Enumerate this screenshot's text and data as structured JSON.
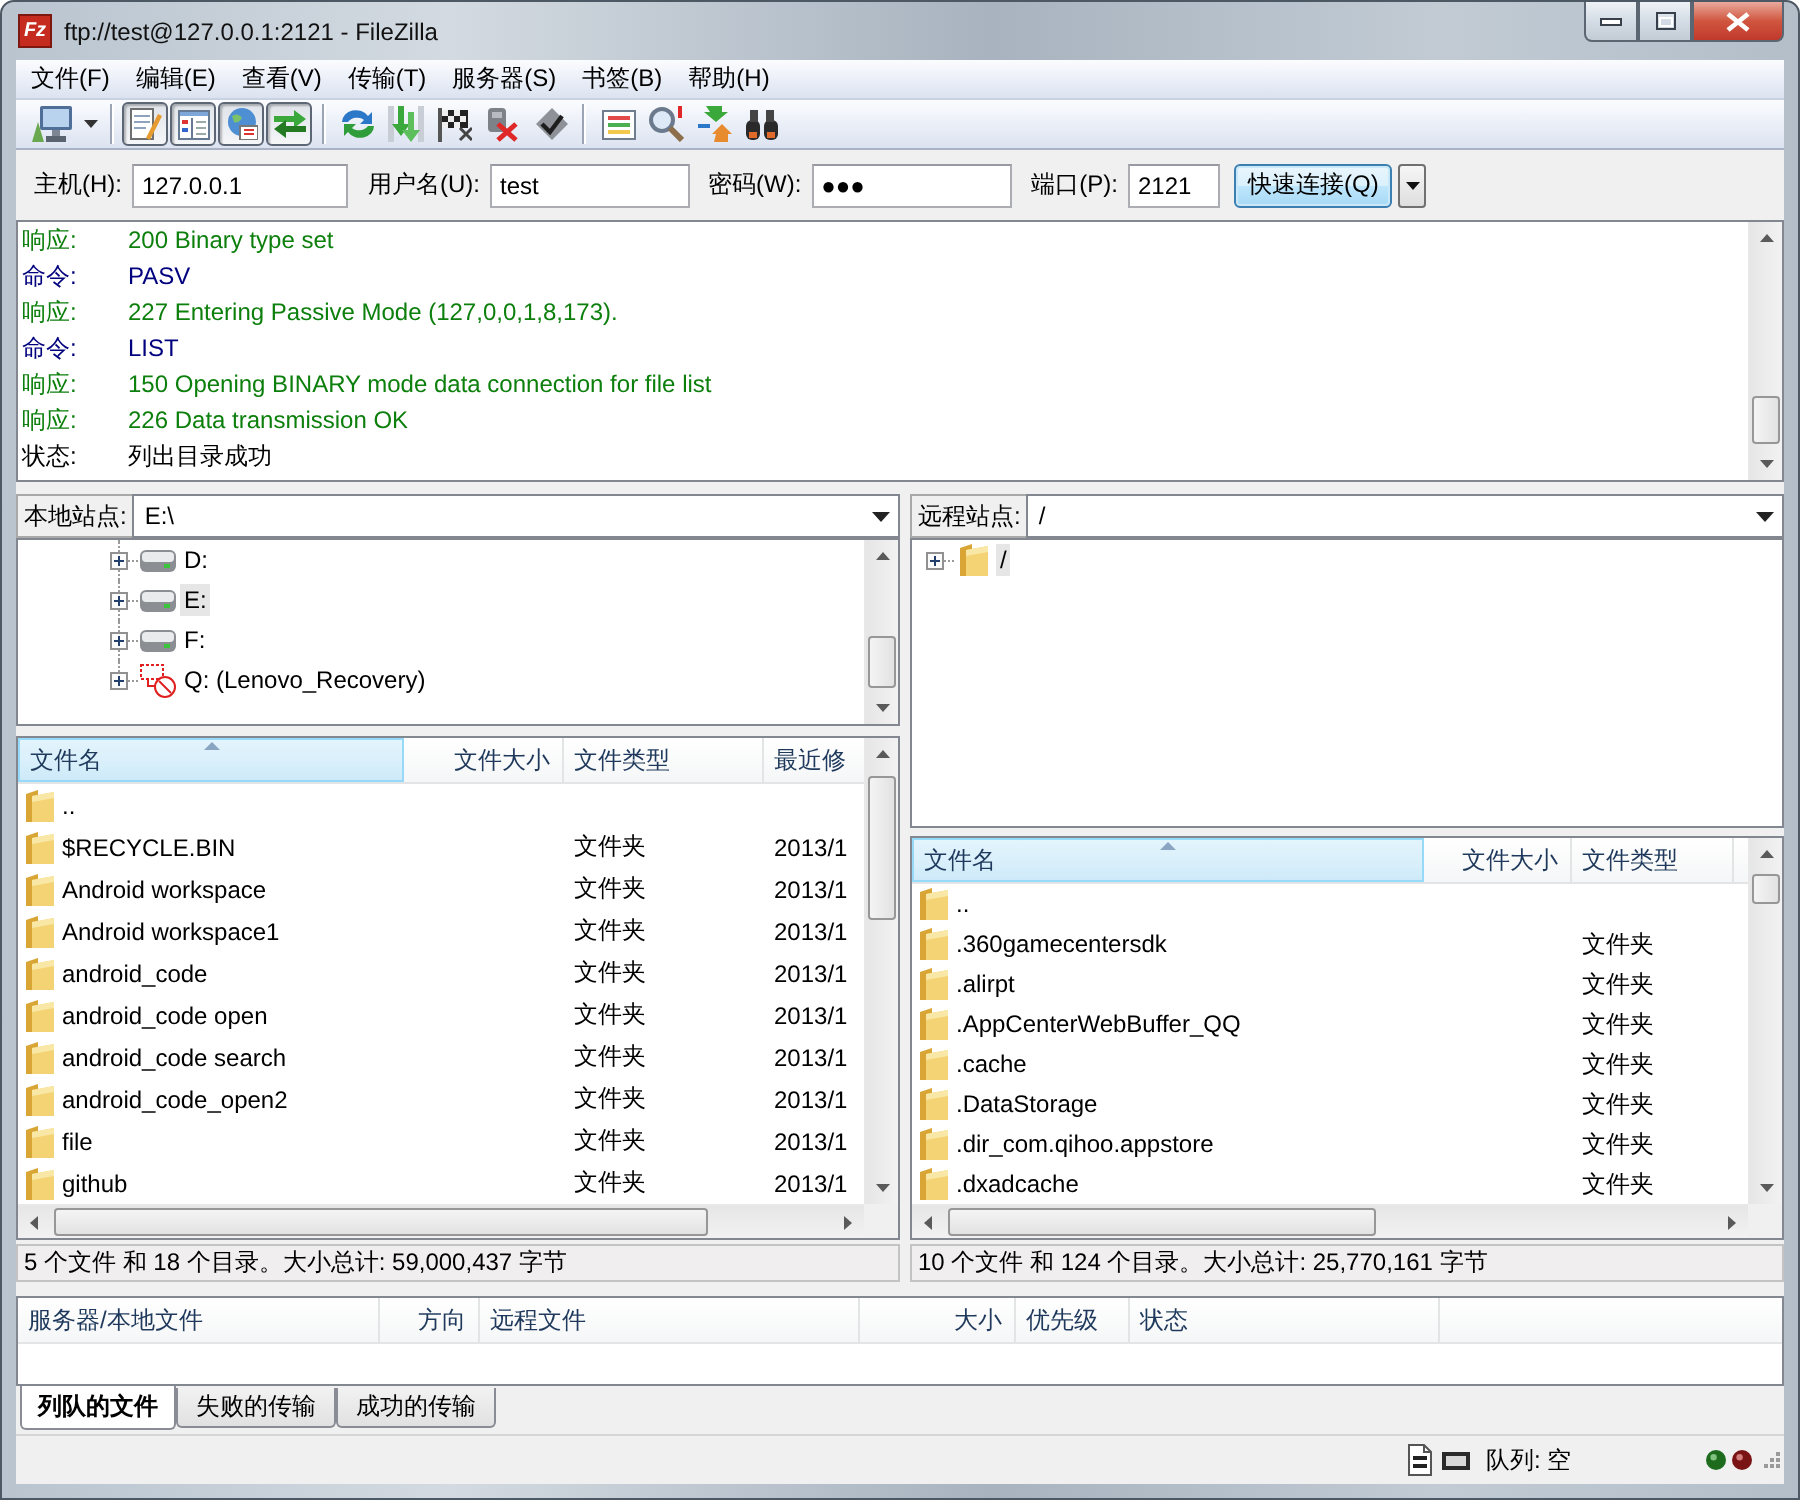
{
  "window": {
    "logo": "Fz",
    "title": "ftp://test@127.0.0.1:2121 - FileZilla"
  },
  "menu": [
    "文件(F)",
    "编辑(E)",
    "查看(V)",
    "传输(T)",
    "服务器(S)",
    "书签(B)",
    "帮助(H)"
  ],
  "toolbar": {
    "view_toggles": [
      {
        "on": true
      },
      {
        "on": true
      },
      {
        "on": true
      },
      {
        "on": true
      }
    ]
  },
  "quickconnect": {
    "host": {
      "label": "主机(H):",
      "value": "127.0.0.1"
    },
    "username": {
      "label": "用户名(U):",
      "value": "test"
    },
    "password": {
      "label": "密码(W):",
      "value": "●●●"
    },
    "port": {
      "label": "端口(P):",
      "value": "2121"
    },
    "button": "快速连接(Q)"
  },
  "log": [
    {
      "kind": "response",
      "label": "响应:",
      "message": "200 Binary type set"
    },
    {
      "kind": "command",
      "label": "命令:",
      "message": "PASV"
    },
    {
      "kind": "response",
      "label": "响应:",
      "message": "227 Entering Passive Mode (127,0,0,1,8,173)."
    },
    {
      "kind": "command",
      "label": "命令:",
      "message": "LIST"
    },
    {
      "kind": "response",
      "label": "响应:",
      "message": "150 Opening BINARY mode data connection for file list"
    },
    {
      "kind": "response",
      "label": "响应:",
      "message": "226 Data transmission OK"
    },
    {
      "kind": "status",
      "label": "状态:",
      "message": "列出目录成功"
    }
  ],
  "local_site": {
    "label": "本地站点:",
    "path": "E:\\",
    "tree": [
      {
        "kind": "drive",
        "label": "D:",
        "expanded": false,
        "selected": false
      },
      {
        "kind": "drive",
        "label": "E:",
        "expanded": false,
        "selected": true
      },
      {
        "kind": "drive",
        "label": "F:",
        "expanded": false,
        "selected": false
      },
      {
        "kind": "disconnected_drive",
        "label": "Q: (Lenovo_Recovery)",
        "expanded": false,
        "selected": false
      }
    ],
    "columns": [
      {
        "label": "文件名",
        "sorted": true
      },
      {
        "label": "文件大小",
        "sorted": false
      },
      {
        "label": "文件类型",
        "sorted": false
      },
      {
        "label": "最近修",
        "sorted": false
      }
    ],
    "rows": [
      {
        "name": ".."
      },
      {
        "name": "$RECYCLE.BIN",
        "type": "文件夹",
        "modified": "2013/1"
      },
      {
        "name": "Android workspace",
        "type": "文件夹",
        "modified": "2013/1"
      },
      {
        "name": "Android workspace1",
        "type": "文件夹",
        "modified": "2013/1"
      },
      {
        "name": "android_code",
        "type": "文件夹",
        "modified": "2013/1"
      },
      {
        "name": "android_code open",
        "type": "文件夹",
        "modified": "2013/1"
      },
      {
        "name": "android_code search",
        "type": "文件夹",
        "modified": "2013/1"
      },
      {
        "name": "android_code_open2",
        "type": "文件夹",
        "modified": "2013/1"
      },
      {
        "name": "file",
        "type": "文件夹",
        "modified": "2013/1"
      },
      {
        "name": "github",
        "type": "文件夹",
        "modified": "2013/1"
      }
    ],
    "status": "5 个文件 和 18 个目录。大小总计: 59,000,437 字节"
  },
  "remote_site": {
    "label": "远程站点:",
    "path": "/",
    "tree": [
      {
        "kind": "folder",
        "label": "/",
        "expanded": false,
        "selected": true
      }
    ],
    "columns": [
      {
        "label": "文件名",
        "sorted": true
      },
      {
        "label": "文件大小",
        "sorted": false
      },
      {
        "label": "文件类型",
        "sorted": false
      }
    ],
    "rows": [
      {
        "name": ".."
      },
      {
        "name": ".360gamecentersdk",
        "type": "文件夹"
      },
      {
        "name": ".alirpt",
        "type": "文件夹"
      },
      {
        "name": ".AppCenterWebBuffer_QQ",
        "type": "文件夹"
      },
      {
        "name": ".cache",
        "type": "文件夹"
      },
      {
        "name": ".DataStorage",
        "type": "文件夹"
      },
      {
        "name": ".dir_com.qihoo.appstore",
        "type": "文件夹"
      },
      {
        "name": ".dxadcache",
        "type": "文件夹"
      }
    ],
    "status": "10 个文件 和 124 个目录。大小总计: 25,770,161 字节"
  },
  "queue": {
    "columns": [
      "服务器/本地文件",
      "方向",
      "远程文件",
      "大小",
      "优先级",
      "状态"
    ],
    "tabs": [
      {
        "label": "列队的文件",
        "selected": true
      },
      {
        "label": "失败的传输",
        "selected": false
      },
      {
        "label": "成功的传输",
        "selected": false
      }
    ]
  },
  "status_bar": {
    "queue": "队列: 空"
  }
}
